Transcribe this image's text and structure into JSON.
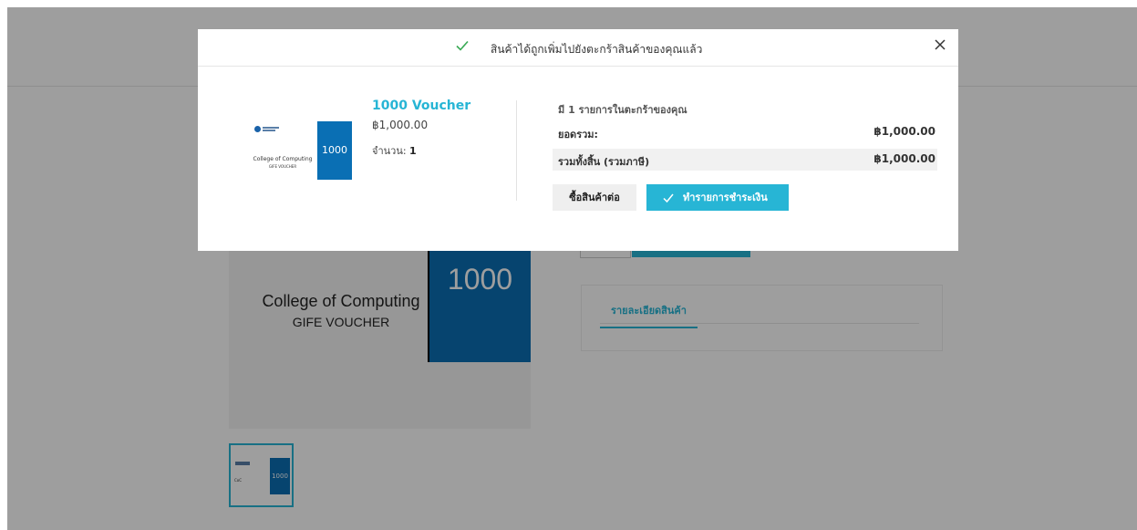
{
  "background": {
    "voucher_title": "College of Computing",
    "voucher_subtitle": "GIFE VOUCHER",
    "voucher_value": "1000",
    "thumb_value": "1000",
    "tab_label": "รายละเอียดสินค้า"
  },
  "modal": {
    "message": "สินค้าได้ถูกเพิ่มไปยังตะกร้าสินค้าของคุณแล้ว",
    "icons": {
      "success": "check-icon",
      "close": "close-icon"
    },
    "product": {
      "image_text_line1": "College of Computing",
      "image_text_line2": "GIFE VOUCHER",
      "image_value": "1000",
      "name": "1000 Voucher",
      "price": "฿1,000.00",
      "qty_label": "จำนวน:",
      "qty_value": "1"
    },
    "summary": {
      "cart_count_text": "มี 1 รายการในตะกร้าของคุณ",
      "subtotal_label": "ยอดรวม:",
      "subtotal_value": "฿1,000.00",
      "total_label": "รวมทั้งสิ้น (รวมภาษี)",
      "total_value": "฿1,000.00"
    },
    "buttons": {
      "continue": "ซื้อสินค้าต่อ",
      "checkout": "ทำรายการชำระเงิน"
    }
  },
  "colors": {
    "accent": "#27b5d5",
    "voucher_blue": "#0a6fb4",
    "success_green": "#3aaa55"
  }
}
